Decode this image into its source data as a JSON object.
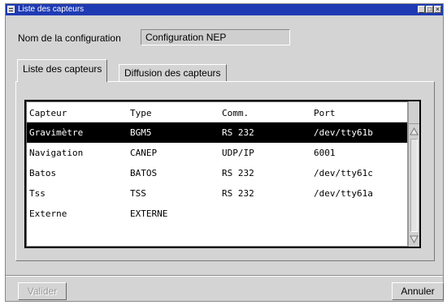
{
  "window": {
    "title": "Liste des capteurs",
    "buttons": {
      "minimize": "_",
      "maximize": "□",
      "close": "×"
    }
  },
  "config": {
    "label": "Nom de la configuration",
    "value": "Configuration NEP"
  },
  "tabs": [
    {
      "label": "Liste des capteurs",
      "active": true
    },
    {
      "label": "Diffusion des capteurs",
      "active": false
    }
  ],
  "sensors": {
    "columns": [
      "Capteur",
      "Type",
      "Comm.",
      "Port"
    ],
    "rows": [
      {
        "capteur": "Gravimètre",
        "type": "BGM5",
        "comm": "RS 232",
        "port": "/dev/tty61b",
        "selected": true
      },
      {
        "capteur": "Navigation",
        "type": "CANEP",
        "comm": "UDP/IP",
        "port": "6001",
        "selected": false
      },
      {
        "capteur": "Batos",
        "type": "BATOS",
        "comm": "RS 232",
        "port": "/dev/tty61c",
        "selected": false
      },
      {
        "capteur": "Tss",
        "type": "TSS",
        "comm": "RS 232",
        "port": "/dev/tty61a",
        "selected": false
      },
      {
        "capteur": "Externe",
        "type": "EXTERNE",
        "comm": "",
        "port": "",
        "selected": false
      }
    ]
  },
  "footer": {
    "valider_label": "Valider",
    "annuler_label": "Annuler"
  },
  "colors": {
    "titlebar": "#1f3bb3",
    "window_bg": "#d4d4d4",
    "selection": "#000000"
  }
}
